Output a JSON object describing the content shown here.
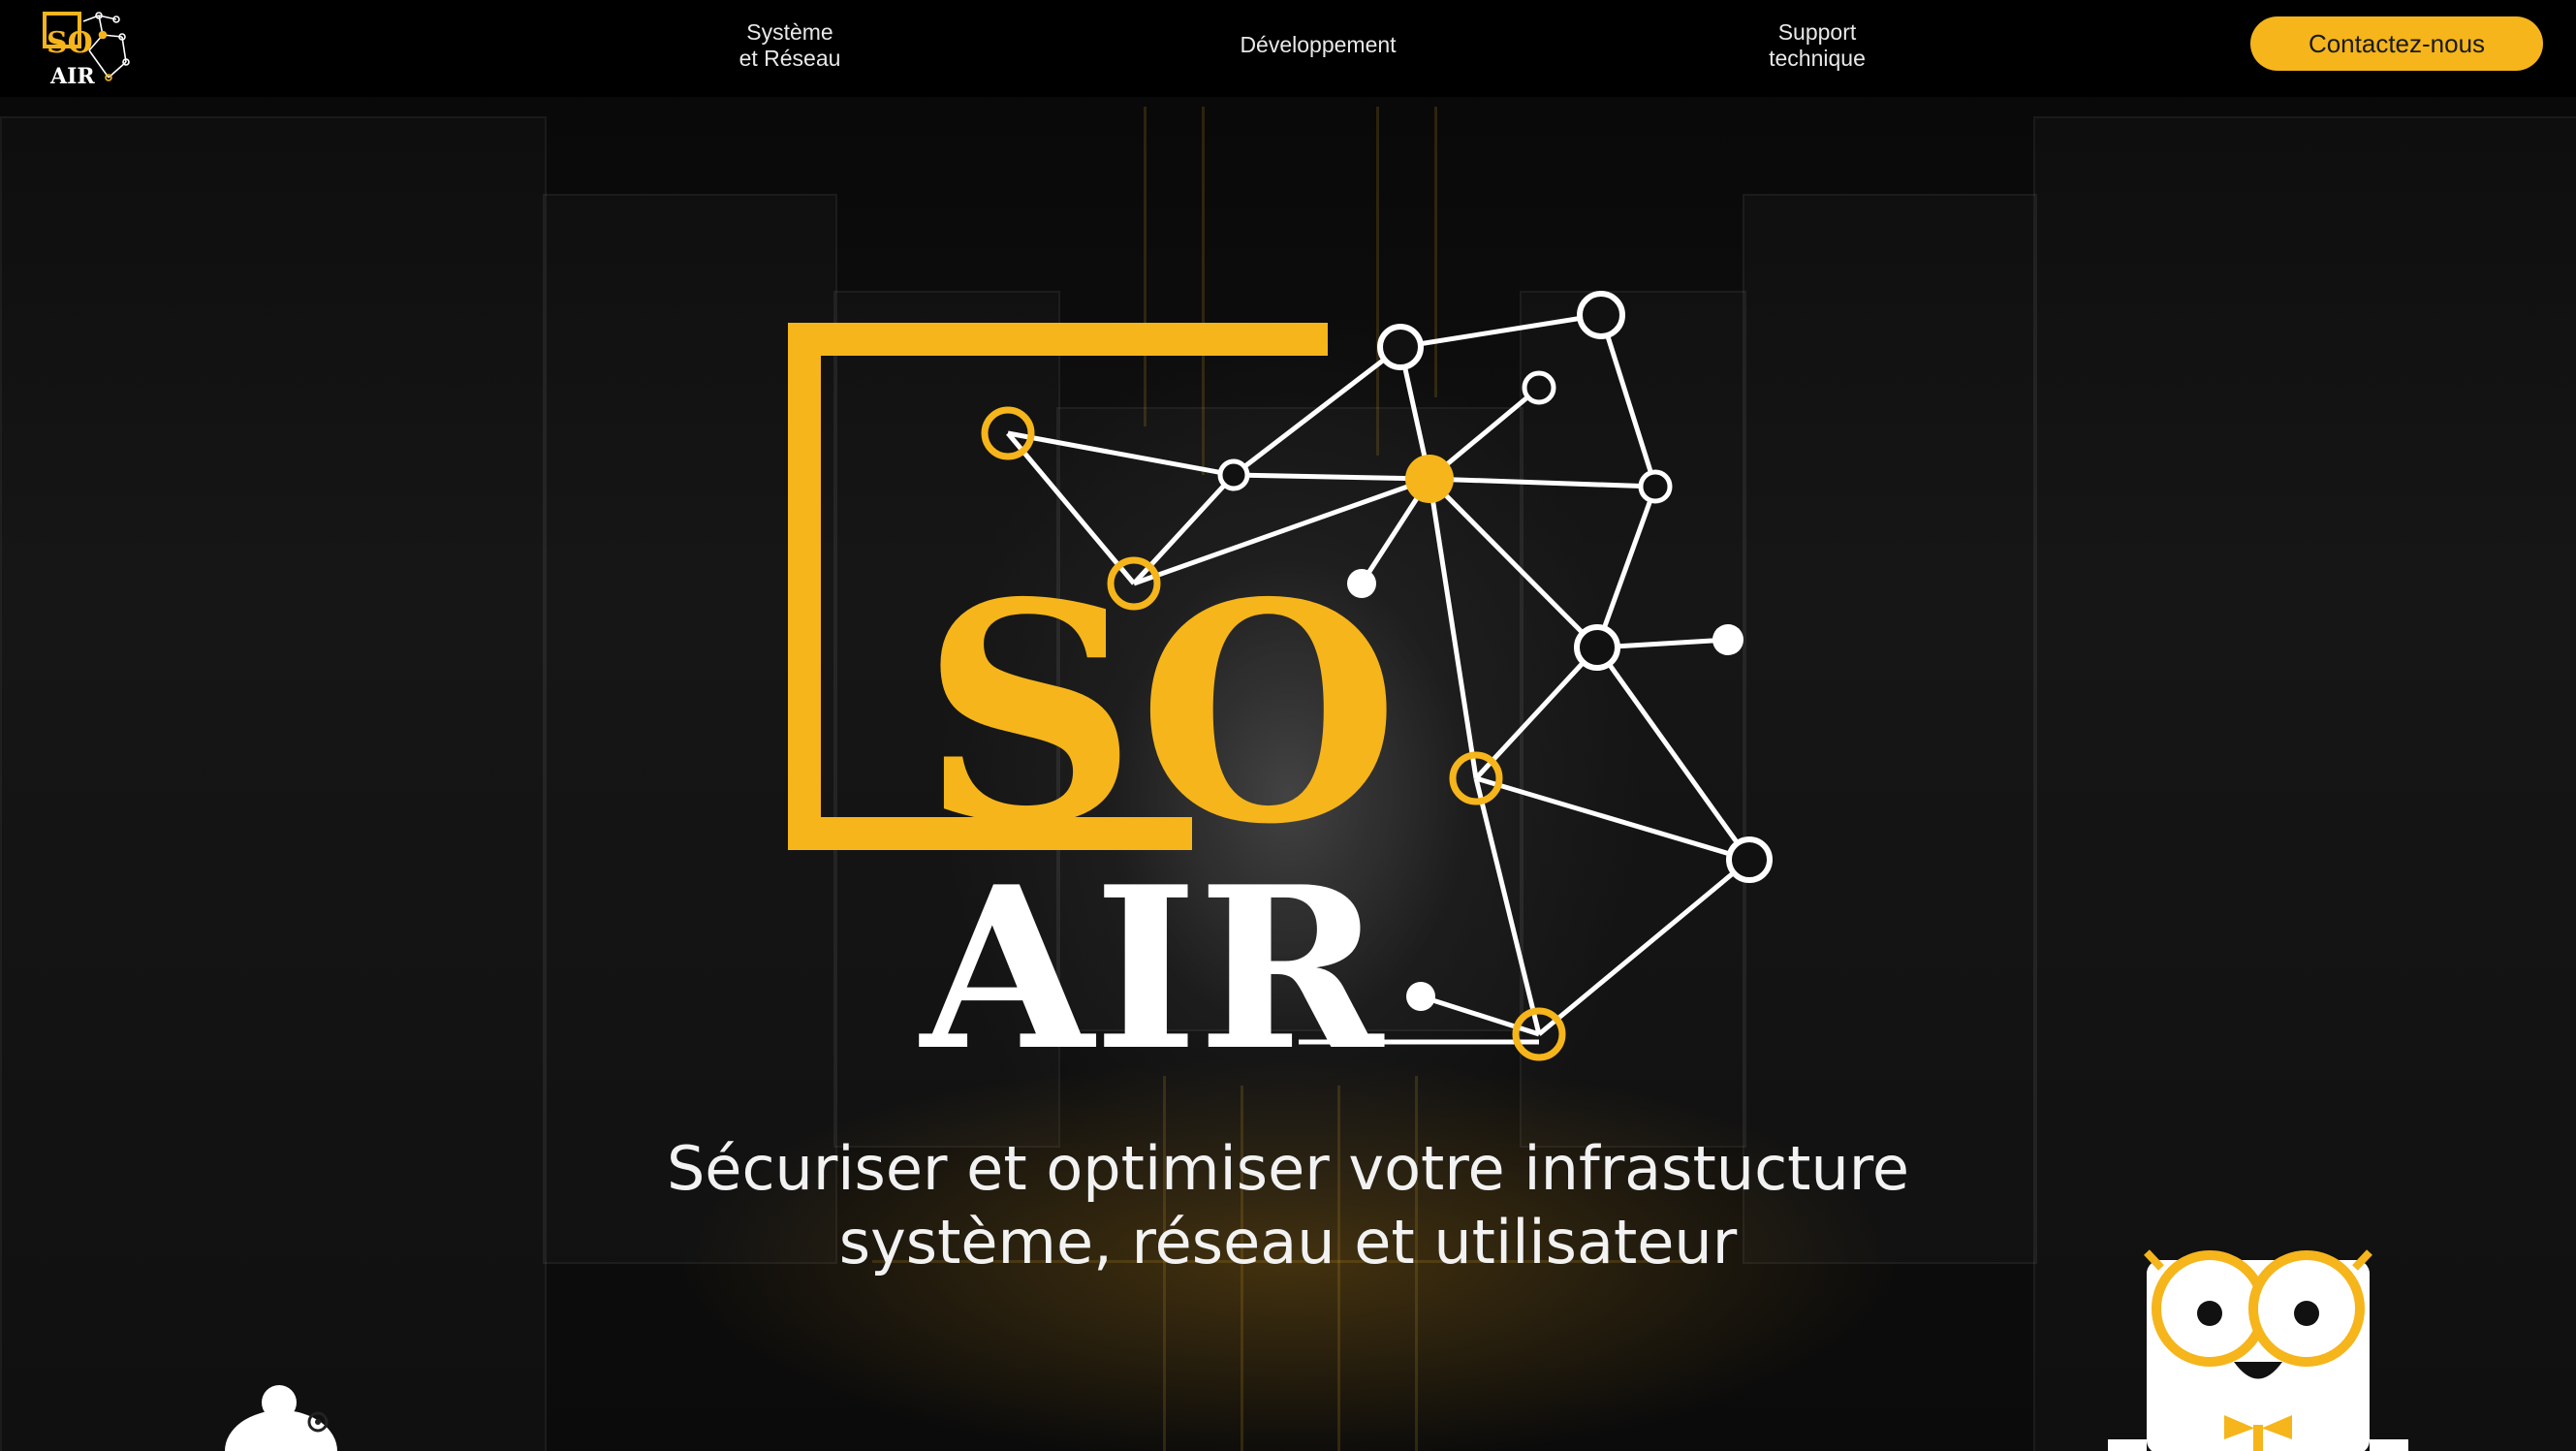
{
  "nav": {
    "logo_text_top": "SO",
    "logo_text_bottom": "AIR",
    "links": [
      {
        "line1": "Système",
        "line2": "et Réseau"
      },
      {
        "line1": "Développement",
        "line2": ""
      },
      {
        "line1": "Support",
        "line2": "technique"
      }
    ],
    "contact_label": "Contactez-nous"
  },
  "hero": {
    "logo_text_top": "SO",
    "logo_text_bottom": "AIR",
    "tagline_line1": "Sécuriser et optimiser votre infrastucture",
    "tagline_line2": "système, réseau et utilisateur"
  },
  "colors": {
    "accent": "#f5b51b",
    "background": "#050505",
    "text": "#f2f2f2"
  }
}
